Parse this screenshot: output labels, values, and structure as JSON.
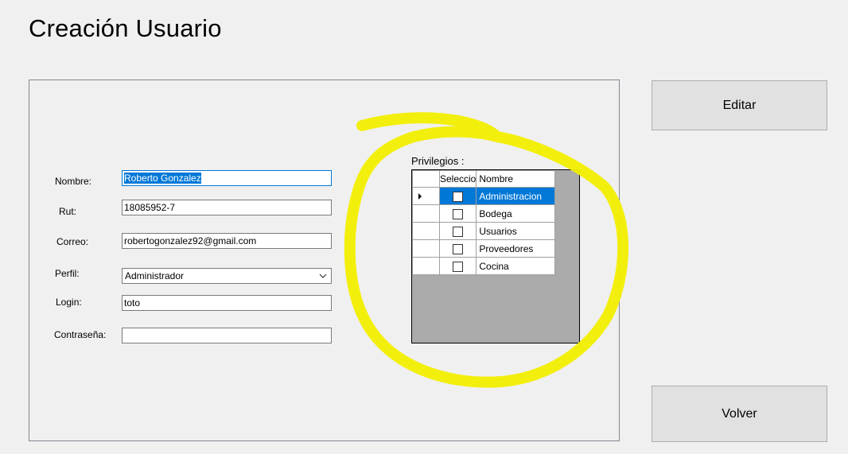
{
  "form": {
    "title": "Creación Usuario",
    "fields": {
      "nombre": {
        "label": "Nombre:",
        "value": "Roberto Gonzalez"
      },
      "rut": {
        "label": "Rut:",
        "value": "18085952-7"
      },
      "correo": {
        "label": "Correo:",
        "value": "robertogonzalez92@gmail.com"
      },
      "perfil": {
        "label": "Perfil:",
        "value": "Administrador"
      },
      "login": {
        "label": "Login:",
        "value": "toto"
      },
      "contrasena": {
        "label": "Contraseña:",
        "value": ""
      }
    }
  },
  "privileges": {
    "label": "Privilegios :",
    "columns": [
      "Seleccio",
      "Nombre"
    ],
    "rows": [
      {
        "checked": false,
        "name": "Administracion"
      },
      {
        "checked": false,
        "name": "Bodega"
      },
      {
        "checked": false,
        "name": "Usuarios"
      },
      {
        "checked": false,
        "name": "Proveedores"
      },
      {
        "checked": false,
        "name": "Cocina"
      }
    ]
  },
  "buttons": {
    "edit": "Editar",
    "back": "Volver"
  },
  "colors": {
    "selection": "#0078d7",
    "highlight_marker": "#f2ee00",
    "grid_empty": "#ababab"
  }
}
